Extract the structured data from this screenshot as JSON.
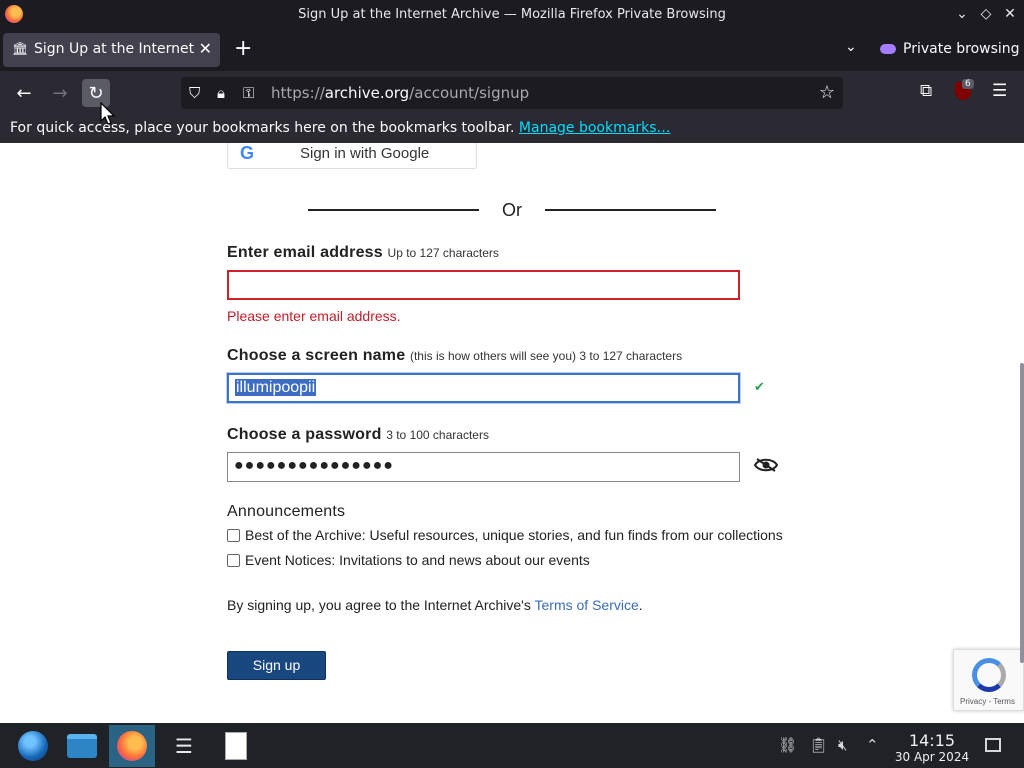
{
  "window": {
    "title": "Sign Up at the Internet Archive — Mozilla Firefox Private Browsing"
  },
  "tabs": [
    {
      "title": "Sign Up at the Internet Archive",
      "icon": "archive-icon"
    }
  ],
  "tabbar": {
    "private_label": "Private browsing"
  },
  "urlbar": {
    "scheme": "https://",
    "domain": "archive.org",
    "path": "/account/signup"
  },
  "extensions": {
    "ublock_count": "6"
  },
  "bookmarks_bar": {
    "message": "For quick access, place your bookmarks here on the bookmarks toolbar.",
    "link": "Manage bookmarks…"
  },
  "form": {
    "google_button": "Sign in with Google",
    "or_label": "Or",
    "email": {
      "label": "Enter email address",
      "hint": "Up to 127 characters",
      "value": "",
      "error": "Please enter email address."
    },
    "screen_name": {
      "label": "Choose a screen name",
      "hint": "(this is how others will see you) 3 to 127 characters",
      "value": "illumipoopii",
      "valid_mark": "✔"
    },
    "password": {
      "label": "Choose a password",
      "hint": "3 to 100 characters",
      "value_masked": "●●●●●●●●●●●●●●●"
    },
    "announcements": {
      "title": "Announcements",
      "options": [
        {
          "label": "Best of the Archive: Useful resources, unique stories, and fun finds from our collections",
          "checked": false
        },
        {
          "label": "Event Notices: Invitations to and news about our events",
          "checked": false
        }
      ]
    },
    "terms": {
      "prefix": "By signing up, you agree to the Internet Archive's",
      "link": "Terms of Service",
      "suffix": "."
    },
    "submit_label": "Sign up"
  },
  "recaptcha": {
    "footer": "Privacy - Terms"
  },
  "taskbar": {
    "time": "14:15",
    "date": "30 Apr 2024"
  },
  "colors": {
    "accent_link": "#3b6db5",
    "error": "#d0202a",
    "submit_bg": "#194880",
    "focus_border": "#3f74c4",
    "valid_green": "#2f9e55"
  }
}
